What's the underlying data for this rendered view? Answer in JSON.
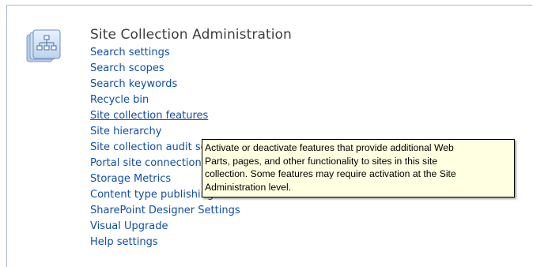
{
  "section": {
    "icon": "site-hierarchy-icon",
    "title": "Site Collection Administration"
  },
  "links": [
    {
      "label": "Search settings",
      "name": "link-search-settings"
    },
    {
      "label": "Search scopes",
      "name": "link-search-scopes"
    },
    {
      "label": "Search keywords",
      "name": "link-search-keywords"
    },
    {
      "label": "Recycle bin",
      "name": "link-recycle-bin"
    },
    {
      "label": "Site collection features",
      "name": "link-site-collection-features",
      "hovered": true
    },
    {
      "label": "Site hierarchy",
      "name": "link-site-hierarchy"
    },
    {
      "label": "Site collection audit settings",
      "name": "link-site-collection-audit-settings"
    },
    {
      "label": "Portal site connection",
      "name": "link-portal-site-connection"
    },
    {
      "label": "Storage Metrics",
      "name": "link-storage-metrics"
    },
    {
      "label": "Content type publishing",
      "name": "link-content-type-publishing"
    },
    {
      "label": "SharePoint Designer Settings",
      "name": "link-sharepoint-designer-settings"
    },
    {
      "label": "Visual Upgrade",
      "name": "link-visual-upgrade"
    },
    {
      "label": "Help settings",
      "name": "link-help-settings"
    }
  ],
  "tooltip": {
    "text": "Activate or deactivate features that provide additional Web\nParts, pages, and other functionality to sites in this site\ncollection. Some features may require activation at the Site\nAdministration level."
  },
  "colors": {
    "link": "#0f4ea8",
    "title": "#3d3d3d",
    "tooltip_bg": "#ffffe1"
  }
}
